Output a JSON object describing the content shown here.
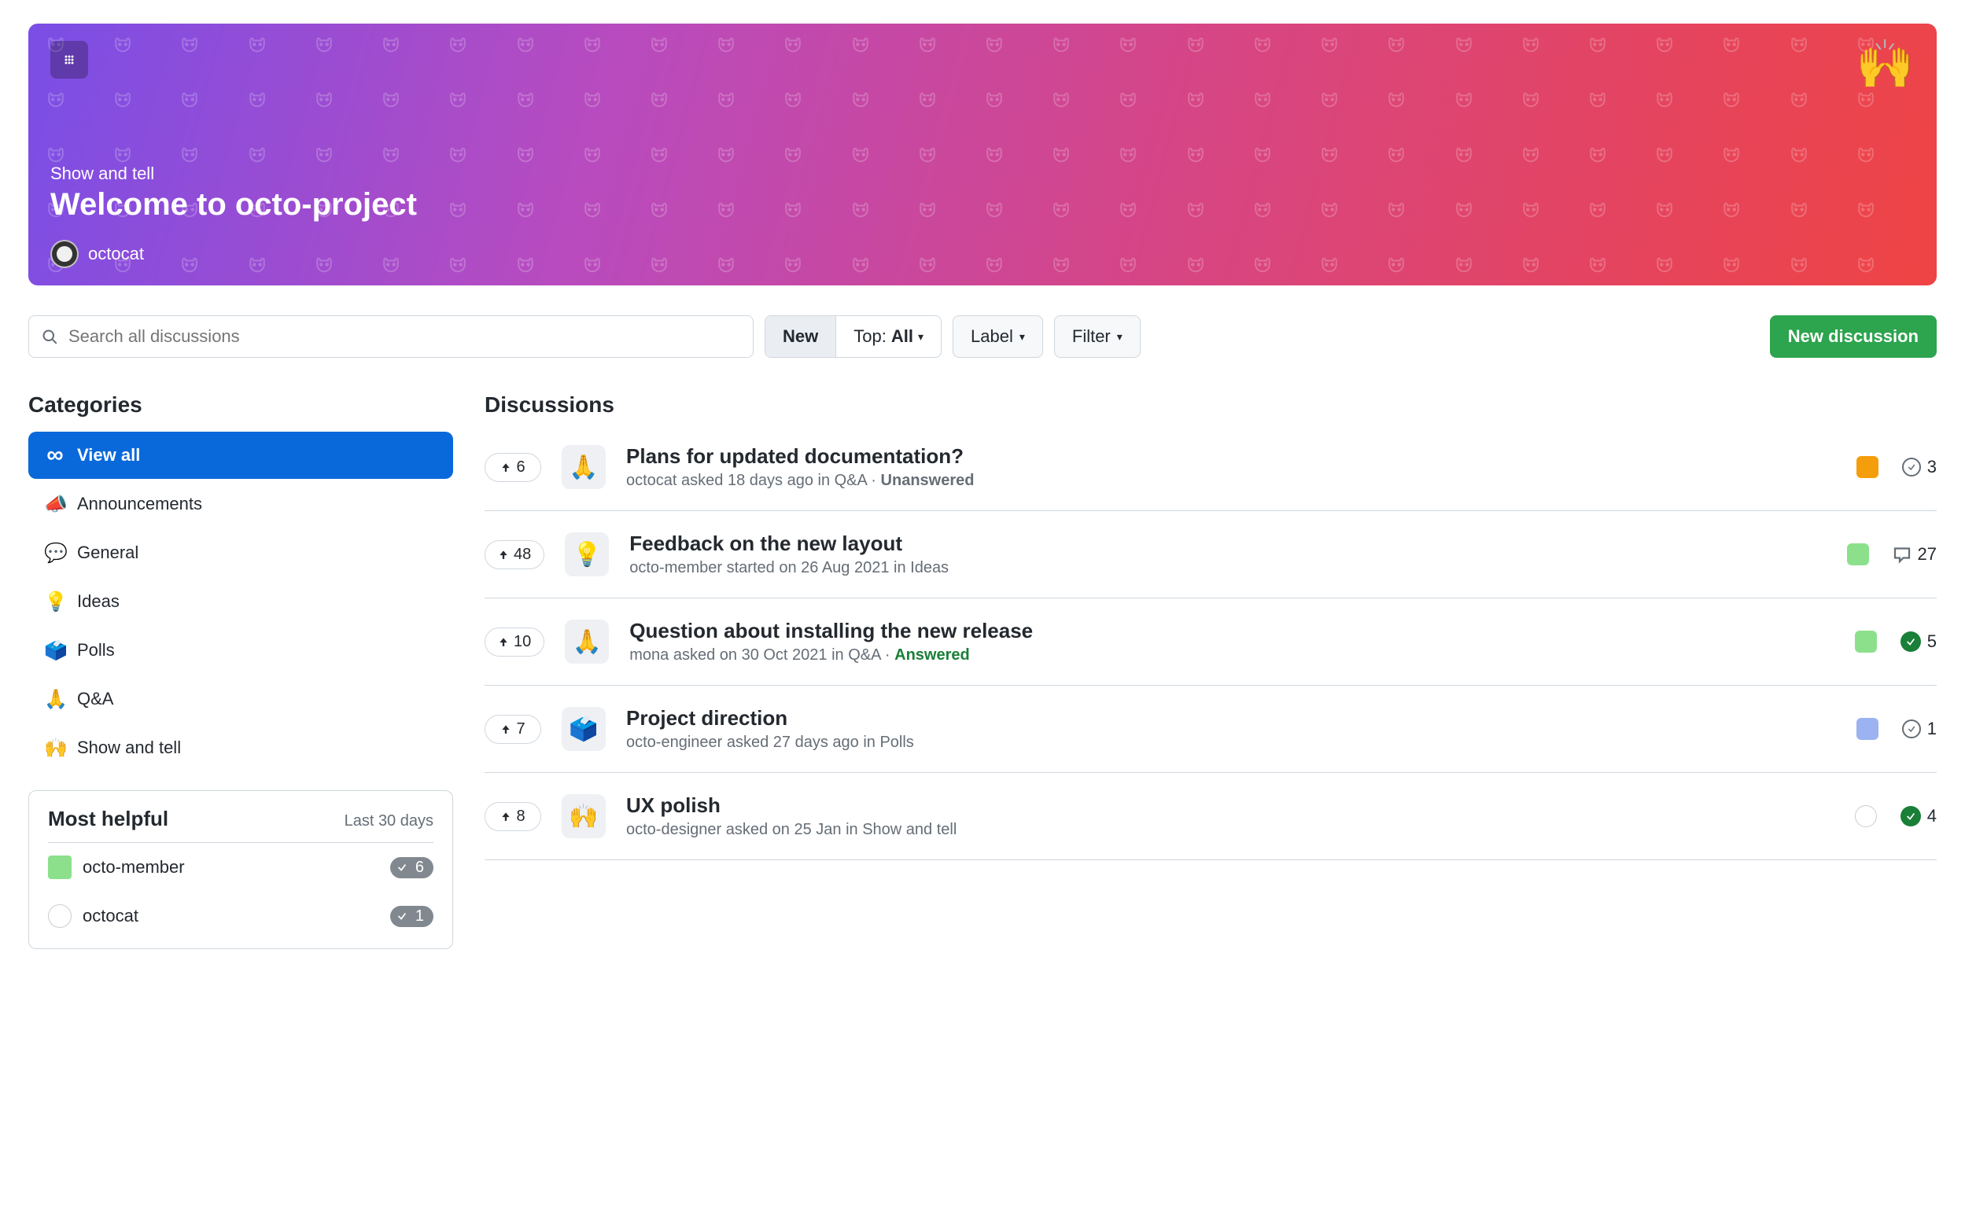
{
  "hero": {
    "category": "Show and tell",
    "title": "Welcome to octo-project",
    "user": "octocat",
    "emoji": "🙌"
  },
  "toolbar": {
    "search_placeholder": "Search all discussions",
    "segmented": {
      "new": "New",
      "top_prefix": "Top:",
      "top_value": "All"
    },
    "label_btn": "Label",
    "filter_btn": "Filter",
    "new_btn": "New discussion"
  },
  "sidebar": {
    "title": "Categories",
    "items": [
      {
        "label": "View all",
        "emoji": "∞",
        "active": true
      },
      {
        "label": "Announcements",
        "emoji": "📣"
      },
      {
        "label": "General",
        "emoji": "💬"
      },
      {
        "label": "Ideas",
        "emoji": "💡"
      },
      {
        "label": "Polls",
        "emoji": "🗳️"
      },
      {
        "label": "Q&A",
        "emoji": "🙏"
      },
      {
        "label": "Show and tell",
        "emoji": "🙌"
      }
    ],
    "helpful": {
      "title": "Most helpful",
      "subtitle": "Last 30 days",
      "rows": [
        {
          "user": "octo-member",
          "count": "6",
          "avatar": "green"
        },
        {
          "user": "octocat",
          "count": "1",
          "avatar": "white"
        }
      ]
    }
  },
  "discussions": {
    "title": "Discussions",
    "items": [
      {
        "upvotes": "6",
        "icon": "🙏",
        "title": "Plans for updated documentation?",
        "meta": "octocat asked 18 days ago in Q&A",
        "status": "Unanswered",
        "status_kind": "unans",
        "avatar": "orange",
        "count_kind": "open",
        "count": "3"
      },
      {
        "upvotes": "48",
        "icon": "💡",
        "title": "Feedback on the new layout",
        "meta": "octo-member started on 26 Aug 2021 in Ideas",
        "status": "",
        "status_kind": "",
        "avatar": "green",
        "count_kind": "comment",
        "count": "27"
      },
      {
        "upvotes": "10",
        "icon": "🙏",
        "title": "Question about installing the new release",
        "meta": "mona asked on 30 Oct 2021 in Q&A",
        "status": "Answered",
        "status_kind": "ans",
        "avatar": "green",
        "count_kind": "answered",
        "count": "5"
      },
      {
        "upvotes": "7",
        "icon": "🗳️",
        "title": "Project direction",
        "meta": "octo-engineer asked 27 days ago in Polls",
        "status": "",
        "status_kind": "",
        "avatar": "blue",
        "count_kind": "open",
        "count": "1"
      },
      {
        "upvotes": "8",
        "icon": "🙌",
        "title": "UX polish",
        "meta": "octo-designer asked on 25 Jan in Show and tell",
        "status": "",
        "status_kind": "",
        "avatar": "white",
        "count_kind": "answered",
        "count": "4"
      }
    ]
  }
}
